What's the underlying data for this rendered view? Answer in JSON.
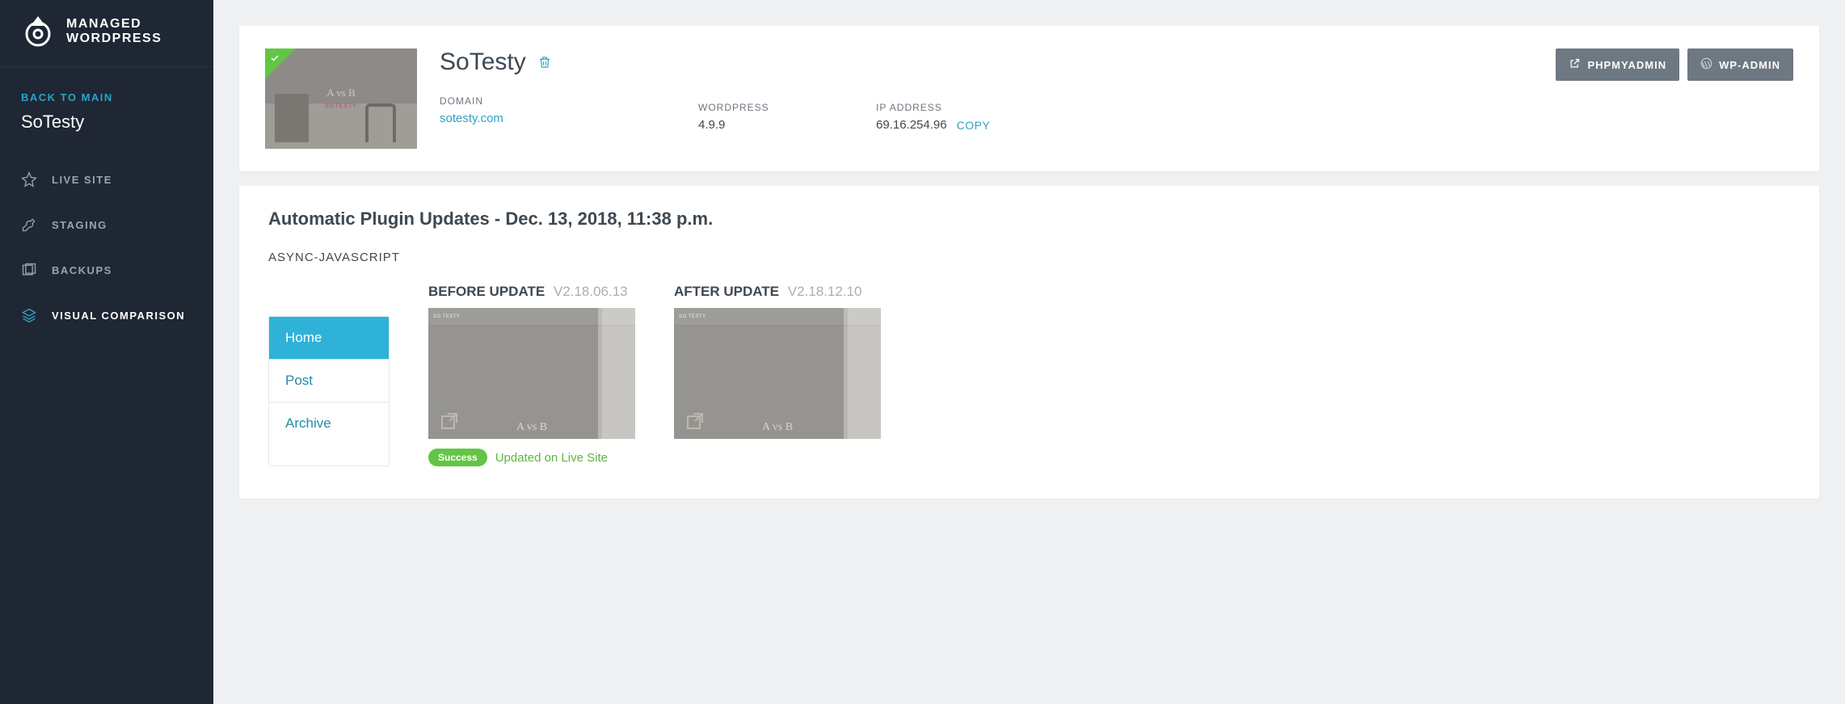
{
  "brand": {
    "line1": "MANAGED",
    "line2": "WORDPRESS"
  },
  "sidebar": {
    "back_label": "BACK TO MAIN",
    "site_name": "SoTesty",
    "items": [
      {
        "label": "LIVE SITE"
      },
      {
        "label": "STAGING"
      },
      {
        "label": "BACKUPS"
      },
      {
        "label": "VISUAL COMPARISON"
      }
    ],
    "active_index": 3
  },
  "header": {
    "site_title": "SoTesty",
    "thumb_overlay_a": "A vs B",
    "thumb_overlay_b": "SOTESTY",
    "domain_label": "DOMAIN",
    "domain_value": "sotesty.com",
    "wordpress_label": "WORDPRESS",
    "wordpress_value": "4.9.9",
    "ip_label": "IP ADDRESS",
    "ip_value": "69.16.254.96",
    "copy_label": "COPY",
    "btn_phpmyadmin": "PHPMYADMIN",
    "btn_wpadmin": "WP-ADMIN"
  },
  "body": {
    "update_title": "Automatic Plugin Updates - Dec. 13, 2018, 11:38 p.m.",
    "plugin_name": "ASYNC-JAVASCRIPT",
    "page_tabs": [
      "Home",
      "Post",
      "Archive"
    ],
    "page_tabs_active": 0,
    "before": {
      "label": "BEFORE UPDATE",
      "version": "V2.18.06.13",
      "caption": "A vs B",
      "tag": "SO TESTY"
    },
    "after": {
      "label": "AFTER UPDATE",
      "version": "V2.18.12.10",
      "caption": "A vs B",
      "tag": "SO TESTY"
    },
    "status_badge": "Success",
    "status_text": "Updated on Live Site"
  }
}
